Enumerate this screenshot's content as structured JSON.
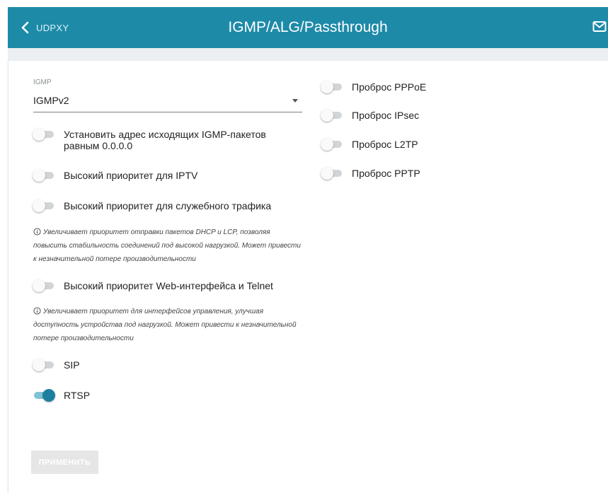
{
  "header": {
    "back_label": "UDPXY",
    "title": "IGMP/ALG/Passthrough"
  },
  "igmp": {
    "label": "IGMP",
    "value": "IGMPv2"
  },
  "left_toggles": {
    "zero_addr": {
      "label": "Установить адрес исходящих IGMP-пакетов равным 0.0.0.0",
      "on": false
    },
    "iptv": {
      "label": "Высокий приоритет для IPTV",
      "on": false
    },
    "service": {
      "label": "Высокий приоритет для служебного трафика",
      "on": false
    },
    "service_hint": "Увеличивает приоритет отправки пакетов DHCP и LCP, позволяя повысить стабильность соединений под высокой нагрузкой. Может привести к незначительной потере производительности",
    "web": {
      "label": "Высокий приоритет Web-интерфейса и Telnet",
      "on": false
    },
    "web_hint": "Увеличивает приоритет для интерфейсов управления, улучшая доступность устройства под нагрузкой. Может привести к незначительной потере производительности",
    "sip": {
      "label": "SIP",
      "on": false
    },
    "rtsp": {
      "label": "RTSP",
      "on": true
    }
  },
  "right_toggles": {
    "pppoe": {
      "label": "Проброс PPPoE",
      "on": false
    },
    "ipsec": {
      "label": "Проброс IPsec",
      "on": false
    },
    "l2tp": {
      "label": "Проброс L2TP",
      "on": false
    },
    "pptp": {
      "label": "Проброс PPTP",
      "on": false
    }
  },
  "apply_label": "ПРИМЕНИТЬ",
  "colors": {
    "header_bg": "#1d8aa8",
    "toggle_on": "#1d7fa0",
    "toggle_off": "#d2d5d8"
  },
  "icons": {
    "back": "chevron-left-icon",
    "mail": "mail-icon",
    "info": "info-icon",
    "dropdown": "caret-down-icon"
  }
}
